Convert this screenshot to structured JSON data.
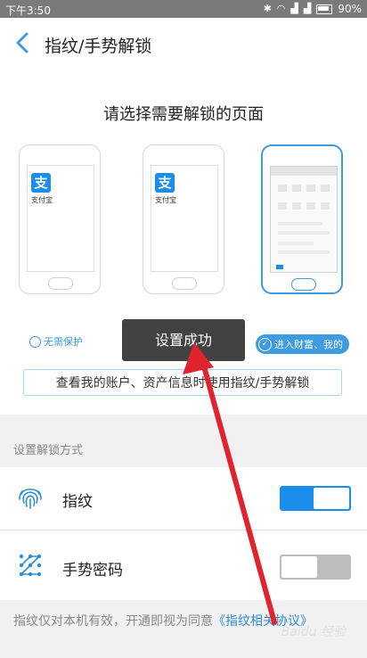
{
  "status_bar": {
    "time": "下午3:50",
    "battery": "90%"
  },
  "header": {
    "title": "指纹/手势解锁"
  },
  "page": {
    "subtitle": "请选择需要解锁的页面"
  },
  "phones": [
    {
      "app_label": "支付宝",
      "app_icon": "支"
    },
    {
      "app_label": "支付宝",
      "app_icon": "支"
    },
    {
      "selected": true
    }
  ],
  "options": [
    {
      "label": "无需保护",
      "selected": false
    },
    {
      "label": "进入财富、我的",
      "selected": true
    }
  ],
  "info_text": "查看我的账户、资产信息时使用指纹/手势解锁",
  "toast": {
    "text": "设置成功"
  },
  "section": {
    "label": "设置解锁方式"
  },
  "settings": [
    {
      "label": "指纹",
      "icon": "fingerprint-icon",
      "enabled": true
    },
    {
      "label": "手势密码",
      "icon": "gesture-icon",
      "enabled": false
    }
  ],
  "footer": {
    "text": "指纹仅对本机有效，开通即视为同意",
    "link": "《指纹相关协议》"
  },
  "watermark": "Baidu 经验",
  "colors": {
    "accent": "#1a8eea",
    "annotation_arrow": "#e0242d"
  }
}
